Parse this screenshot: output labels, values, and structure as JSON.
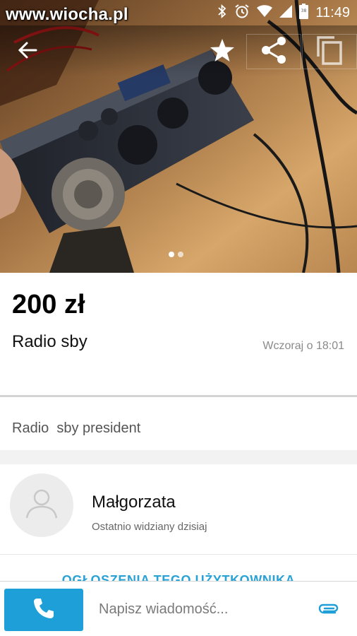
{
  "status_bar": {
    "watermark": "www.wiocha.pl",
    "time": "11:49",
    "icons": [
      "bluetooth-icon",
      "alarm-icon",
      "wifi-icon",
      "signal-icon",
      "battery-icon"
    ]
  },
  "header": {
    "back_icon": "arrow-left-icon",
    "favorite_icon": "star-icon",
    "share_icon": "share-icon",
    "copy_icon": "copy-icon",
    "photo_pages": 2,
    "photo_current": 1
  },
  "listing": {
    "price": "200 zł",
    "title": "Radio sby",
    "date": "Wczoraj o 18:01",
    "description": "Radio  sby president"
  },
  "seller": {
    "name": "Małgorzata",
    "last_seen": "Ostatnio widziany dzisiaj",
    "ads_link": "OGŁOSZENIA TEGO UŻYTKOWNIKA"
  },
  "bottom_bar": {
    "message_placeholder": "Napisz wiadomość...",
    "call_icon": "phone-icon",
    "attach_icon": "paperclip-icon"
  },
  "colors": {
    "accent": "#1f9fd8",
    "link": "#2aa2d6"
  }
}
